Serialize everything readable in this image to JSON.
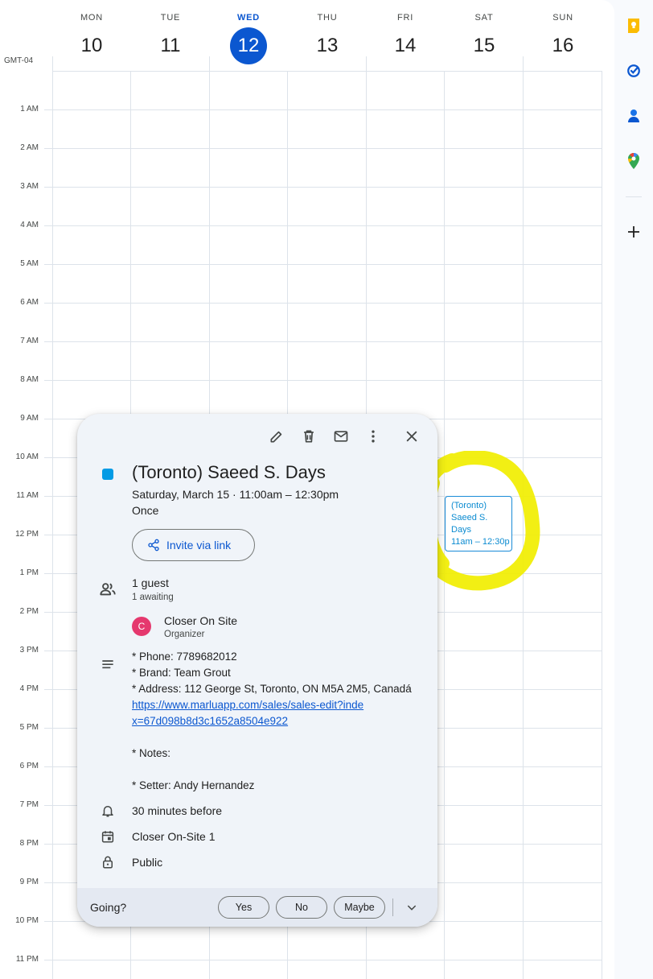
{
  "timezone": "GMT-04",
  "days": [
    {
      "name": "MON",
      "num": "10"
    },
    {
      "name": "TUE",
      "num": "11"
    },
    {
      "name": "WED",
      "num": "12"
    },
    {
      "name": "THU",
      "num": "13"
    },
    {
      "name": "FRI",
      "num": "14"
    },
    {
      "name": "SAT",
      "num": "15"
    },
    {
      "name": "SUN",
      "num": "16"
    }
  ],
  "hours": [
    "1 AM",
    "2 AM",
    "3 AM",
    "4 AM",
    "5 AM",
    "6 AM",
    "7 AM",
    "8 AM",
    "9 AM",
    "10 AM",
    "11 AM",
    "12 PM",
    "1 PM",
    "2 PM",
    "3 PM",
    "4 PM",
    "5 PM",
    "6 PM",
    "7 PM",
    "8 PM",
    "9 PM",
    "10 PM",
    "11 PM"
  ],
  "event_chip": {
    "line1": "(Toronto)",
    "line2": "Saeed S.",
    "line3": "Days",
    "time": "11am – 12:30p"
  },
  "popup": {
    "title": "(Toronto) Saeed S. Days",
    "when": "Saturday, March 15  ·  11:00am – 12:30pm",
    "recurrence": "Once",
    "invite_label": "Invite via link",
    "guests_count": "1 guest",
    "guests_status": "1 awaiting",
    "organizer_initial": "C",
    "organizer_name": "Closer On Site",
    "organizer_role": "Organizer",
    "desc_phone": "* Phone: 7789682012",
    "desc_brand": "* Brand: Team Grout",
    "desc_address": "* Address: 112 George St, Toronto, ON M5A 2M5, Canadá",
    "desc_link": "https://www.marluapp.com/sales/sales-edit?index=67d098b8d3c1652a8504e922",
    "desc_notes": "* Notes:",
    "desc_setter": "* Setter: Andy Hernandez",
    "reminder": "30 minutes before",
    "calendar": "Closer On-Site 1",
    "visibility": "Public",
    "rsvp_prompt": "Going?",
    "rsvp_yes": "Yes",
    "rsvp_no": "No",
    "rsvp_maybe": "Maybe"
  },
  "colors": {
    "accent": "#0b57d0",
    "event": "#039be5",
    "highlight": "#f1ee00",
    "avatar": "#e5386e"
  },
  "icons": {
    "rail": [
      "keep-icon",
      "tasks-icon",
      "contacts-icon",
      "maps-icon",
      "add-icon"
    ],
    "toolbar": [
      "edit-icon",
      "delete-icon",
      "email-icon",
      "more-icon",
      "close-icon"
    ]
  }
}
